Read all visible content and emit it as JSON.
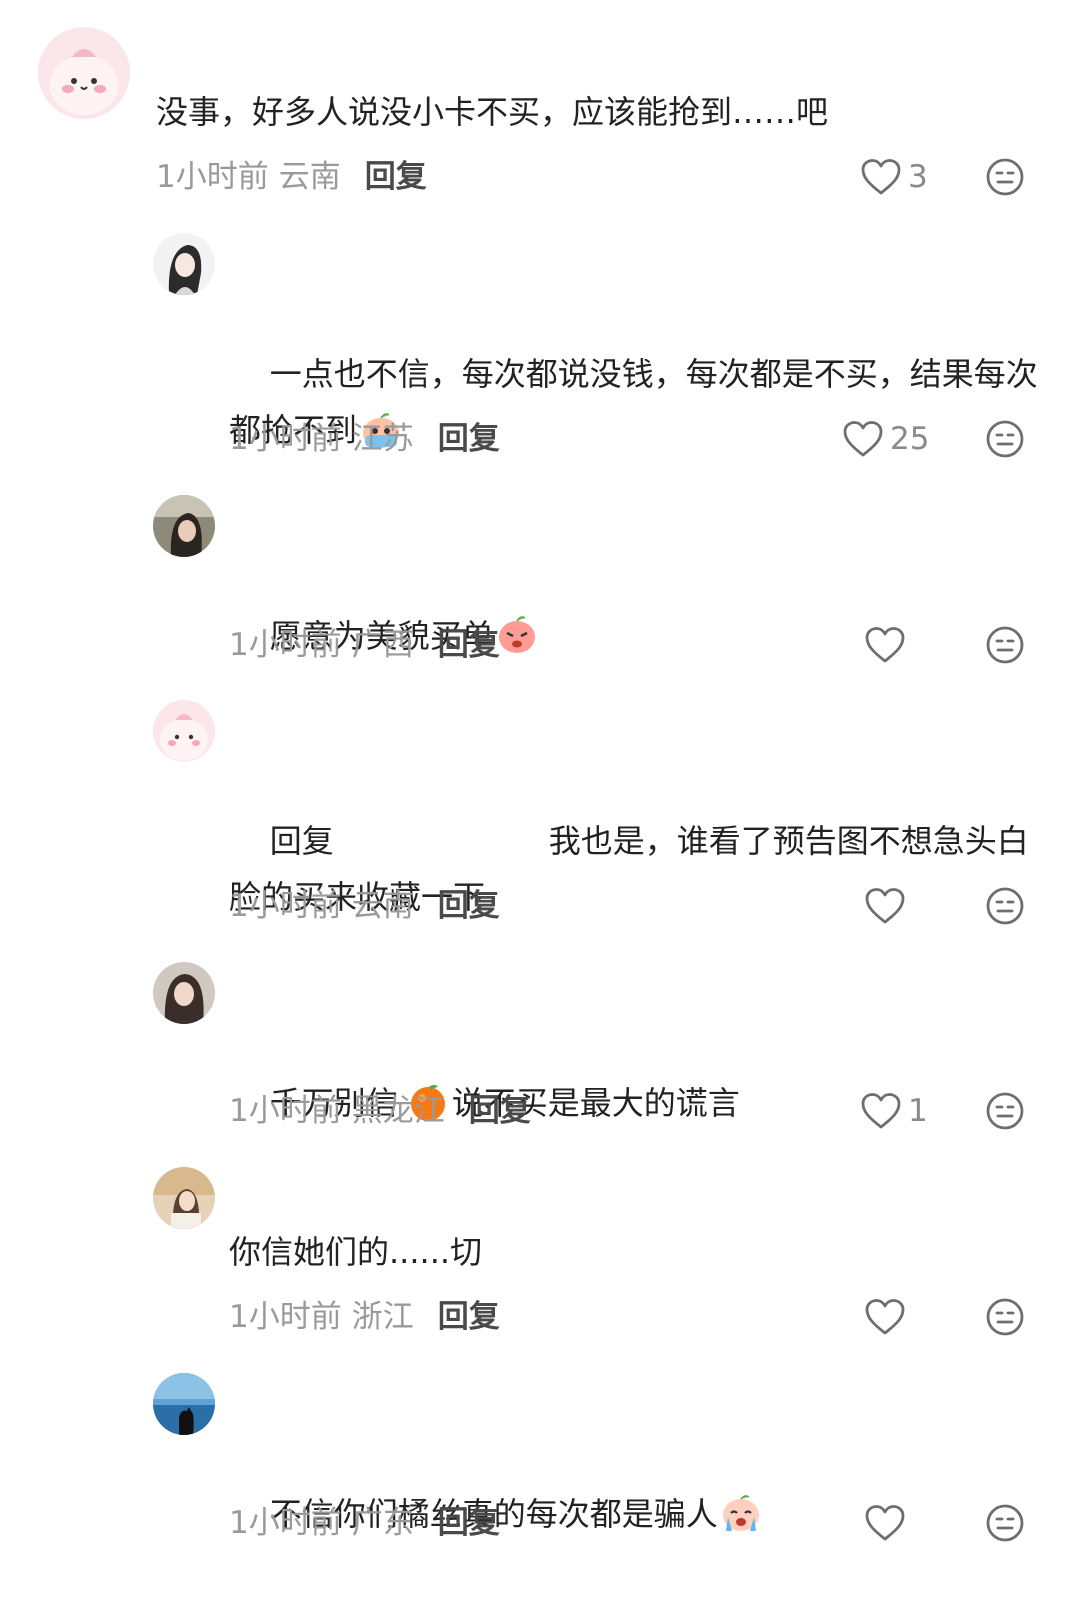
{
  "comments": [
    {
      "text": "没事，好多人说没小卡不买，应该能抢到……吧",
      "time": "1小时前",
      "location": "云南",
      "reply_label": "回复",
      "likes": "3"
    },
    {
      "text": "一点也不信，每次都说没钱，每次都是不买，结果每次都抢不到",
      "time": "1小时前",
      "location": "江苏",
      "reply_label": "回复",
      "likes": "25"
    },
    {
      "text": "愿意为美貌买单",
      "time": "1小时前",
      "location": "广西",
      "reply_label": "回复",
      "likes": ""
    },
    {
      "prefix": "回复",
      "text": "我也是，谁看了预告图不想急头白脸的买来收藏一下",
      "time": "1小时前",
      "location": "云南",
      "reply_label": "回复",
      "likes": ""
    },
    {
      "text_a": "千万别信",
      "text_b": "说不买是最大的谎言",
      "time": "1小时前",
      "location": "黑龙江",
      "reply_label": "回复",
      "likes": "1"
    },
    {
      "text": "你信她们的......切",
      "time": "1小时前",
      "location": "浙江",
      "reply_label": "回复",
      "likes": ""
    },
    {
      "text": "不信你们橘丝真的每次都是骗人",
      "time": "1小时前",
      "location": "广东",
      "reply_label": "回复",
      "likes": ""
    }
  ],
  "icons": {
    "like": "heart-outline-icon",
    "dislike": "neutral-face-icon",
    "emoji_crying_peach": "crying-peach-emoji",
    "emoji_angry_peach": "angry-peach-emoji",
    "emoji_orange": "orange-emoji",
    "emoji_sobbing": "sobbing-face-emoji"
  },
  "colors": {
    "meta_text": "#9a9a9a",
    "reply_text": "#4a4a4a",
    "body_text": "#222222",
    "icon_stroke": "#6e6e6e"
  }
}
